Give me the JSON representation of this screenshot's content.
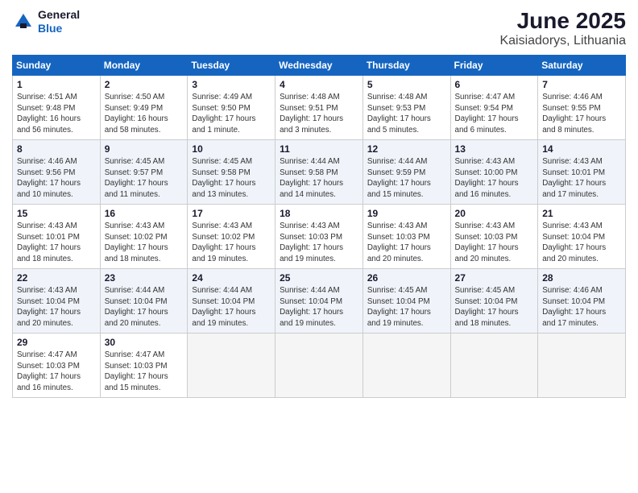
{
  "header": {
    "logo_general": "General",
    "logo_blue": "Blue",
    "title": "June 2025",
    "subtitle": "Kaisiadorys, Lithuania"
  },
  "days_of_week": [
    "Sunday",
    "Monday",
    "Tuesday",
    "Wednesday",
    "Thursday",
    "Friday",
    "Saturday"
  ],
  "weeks": [
    [
      {
        "day": "1",
        "info": "Sunrise: 4:51 AM\nSunset: 9:48 PM\nDaylight: 16 hours\nand 56 minutes."
      },
      {
        "day": "2",
        "info": "Sunrise: 4:50 AM\nSunset: 9:49 PM\nDaylight: 16 hours\nand 58 minutes."
      },
      {
        "day": "3",
        "info": "Sunrise: 4:49 AM\nSunset: 9:50 PM\nDaylight: 17 hours\nand 1 minute."
      },
      {
        "day": "4",
        "info": "Sunrise: 4:48 AM\nSunset: 9:51 PM\nDaylight: 17 hours\nand 3 minutes."
      },
      {
        "day": "5",
        "info": "Sunrise: 4:48 AM\nSunset: 9:53 PM\nDaylight: 17 hours\nand 5 minutes."
      },
      {
        "day": "6",
        "info": "Sunrise: 4:47 AM\nSunset: 9:54 PM\nDaylight: 17 hours\nand 6 minutes."
      },
      {
        "day": "7",
        "info": "Sunrise: 4:46 AM\nSunset: 9:55 PM\nDaylight: 17 hours\nand 8 minutes."
      }
    ],
    [
      {
        "day": "8",
        "info": "Sunrise: 4:46 AM\nSunset: 9:56 PM\nDaylight: 17 hours\nand 10 minutes."
      },
      {
        "day": "9",
        "info": "Sunrise: 4:45 AM\nSunset: 9:57 PM\nDaylight: 17 hours\nand 11 minutes."
      },
      {
        "day": "10",
        "info": "Sunrise: 4:45 AM\nSunset: 9:58 PM\nDaylight: 17 hours\nand 13 minutes."
      },
      {
        "day": "11",
        "info": "Sunrise: 4:44 AM\nSunset: 9:58 PM\nDaylight: 17 hours\nand 14 minutes."
      },
      {
        "day": "12",
        "info": "Sunrise: 4:44 AM\nSunset: 9:59 PM\nDaylight: 17 hours\nand 15 minutes."
      },
      {
        "day": "13",
        "info": "Sunrise: 4:43 AM\nSunset: 10:00 PM\nDaylight: 17 hours\nand 16 minutes."
      },
      {
        "day": "14",
        "info": "Sunrise: 4:43 AM\nSunset: 10:01 PM\nDaylight: 17 hours\nand 17 minutes."
      }
    ],
    [
      {
        "day": "15",
        "info": "Sunrise: 4:43 AM\nSunset: 10:01 PM\nDaylight: 17 hours\nand 18 minutes."
      },
      {
        "day": "16",
        "info": "Sunrise: 4:43 AM\nSunset: 10:02 PM\nDaylight: 17 hours\nand 18 minutes."
      },
      {
        "day": "17",
        "info": "Sunrise: 4:43 AM\nSunset: 10:02 PM\nDaylight: 17 hours\nand 19 minutes."
      },
      {
        "day": "18",
        "info": "Sunrise: 4:43 AM\nSunset: 10:03 PM\nDaylight: 17 hours\nand 19 minutes."
      },
      {
        "day": "19",
        "info": "Sunrise: 4:43 AM\nSunset: 10:03 PM\nDaylight: 17 hours\nand 20 minutes."
      },
      {
        "day": "20",
        "info": "Sunrise: 4:43 AM\nSunset: 10:03 PM\nDaylight: 17 hours\nand 20 minutes."
      },
      {
        "day": "21",
        "info": "Sunrise: 4:43 AM\nSunset: 10:04 PM\nDaylight: 17 hours\nand 20 minutes."
      }
    ],
    [
      {
        "day": "22",
        "info": "Sunrise: 4:43 AM\nSunset: 10:04 PM\nDaylight: 17 hours\nand 20 minutes."
      },
      {
        "day": "23",
        "info": "Sunrise: 4:44 AM\nSunset: 10:04 PM\nDaylight: 17 hours\nand 20 minutes."
      },
      {
        "day": "24",
        "info": "Sunrise: 4:44 AM\nSunset: 10:04 PM\nDaylight: 17 hours\nand 19 minutes."
      },
      {
        "day": "25",
        "info": "Sunrise: 4:44 AM\nSunset: 10:04 PM\nDaylight: 17 hours\nand 19 minutes."
      },
      {
        "day": "26",
        "info": "Sunrise: 4:45 AM\nSunset: 10:04 PM\nDaylight: 17 hours\nand 19 minutes."
      },
      {
        "day": "27",
        "info": "Sunrise: 4:45 AM\nSunset: 10:04 PM\nDaylight: 17 hours\nand 18 minutes."
      },
      {
        "day": "28",
        "info": "Sunrise: 4:46 AM\nSunset: 10:04 PM\nDaylight: 17 hours\nand 17 minutes."
      }
    ],
    [
      {
        "day": "29",
        "info": "Sunrise: 4:47 AM\nSunset: 10:03 PM\nDaylight: 17 hours\nand 16 minutes."
      },
      {
        "day": "30",
        "info": "Sunrise: 4:47 AM\nSunset: 10:03 PM\nDaylight: 17 hours\nand 15 minutes."
      },
      {
        "day": "",
        "info": ""
      },
      {
        "day": "",
        "info": ""
      },
      {
        "day": "",
        "info": ""
      },
      {
        "day": "",
        "info": ""
      },
      {
        "day": "",
        "info": ""
      }
    ]
  ]
}
